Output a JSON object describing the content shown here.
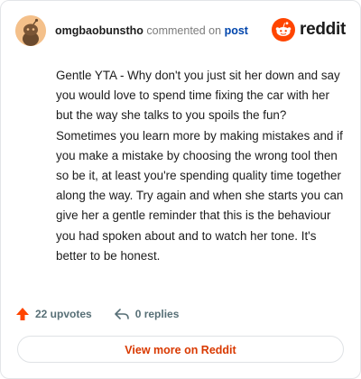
{
  "header": {
    "username": "omgbaobunstho",
    "commented_text": "commented on",
    "post_link": "post",
    "logo_text": "reddit"
  },
  "comment": {
    "body": "Gentle YTA - Why don't you just sit her down and say you would love to spend time fixing the car with her but the way she talks to you spoils the fun? Sometimes you learn more by making mistakes and if you make a mistake by choosing the wrong tool then so be it, at least you're spending quality time together along the way. Try again and when she starts you can give her a gentle reminder that this is the behaviour you had spoken about and to watch her tone. It's better to be honest."
  },
  "actions": {
    "upvotes": "22 upvotes",
    "replies": "0 replies",
    "upvote_icon": "upvote-arrow-icon",
    "reply_icon": "reply-arrow-icon"
  },
  "footer": {
    "view_more_label": "View more on Reddit"
  },
  "colors": {
    "brand": "#ff4500",
    "link": "#0045ac",
    "view_more": "#d93900",
    "muted": "#576f76"
  }
}
